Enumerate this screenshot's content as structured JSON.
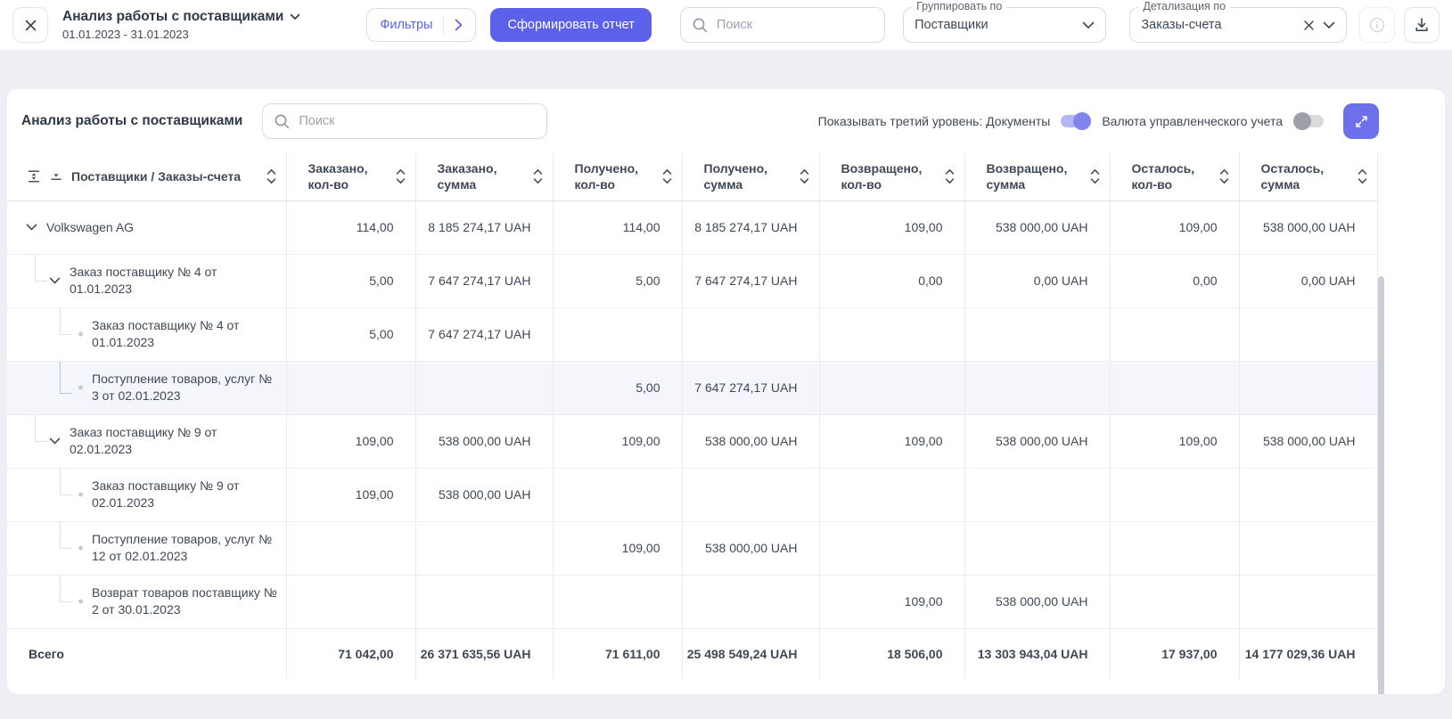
{
  "colors": {
    "accent": "#5c61e9",
    "accent_button": "#6c70ea",
    "toggle_on_track": "#b4b7f4",
    "toggle_on_knob": "#8084ee",
    "toggle_off_knob": "#99a0a9",
    "highlight_row": "#f5f6fc",
    "page_background": "#edeff4"
  },
  "icons": {
    "close": "×",
    "title_chevron": "∨",
    "filters_chevron": "›",
    "search": "⌕",
    "dropdown_chevron": "∨",
    "clear": "×",
    "info": "ⓘ",
    "download": "⭳",
    "expand": "⤢",
    "sort": "∧∨",
    "expand_all_rows": "⇕",
    "collapse_all_rows": "⤓",
    "row_chevron": "∨",
    "doc_bullet": "•"
  },
  "topbar": {
    "title": "Анализ работы с поставщиками",
    "date_range": "01.01.2023 - 31.01.2023",
    "filters_button": "Фильтры",
    "generate_report_button": "Сформировать отчет",
    "search_placeholder": "Поиск",
    "group_by_label": "Группировать по",
    "group_by_value": "Поставщики",
    "detail_by_label": "Детализация по",
    "detail_by_value": "Заказы-счета"
  },
  "panel": {
    "title": "Анализ работы с поставщиками",
    "search_placeholder": "Поиск",
    "third_level_toggle_label": "Показывать третий уровень: Документы",
    "third_level_toggle_on": true,
    "currency_toggle_label": "Валюта управленческого учета",
    "currency_toggle_on": false
  },
  "table": {
    "columns": [
      {
        "title": "Поставщики / Заказы-счета",
        "sub": ""
      },
      {
        "title": "Заказано,",
        "sub": "кол-во"
      },
      {
        "title": "Заказано,",
        "sub": "сумма"
      },
      {
        "title": "Получено,",
        "sub": "кол-во"
      },
      {
        "title": "Получено,",
        "sub": "сумма"
      },
      {
        "title": "Возвращено,",
        "sub": "кол-во"
      },
      {
        "title": "Возвращено,",
        "sub": "сумма"
      },
      {
        "title": "Осталось,",
        "sub": "кол-во"
      },
      {
        "title": "Осталось,",
        "sub": "сумма"
      }
    ],
    "rows": [
      {
        "level": 0,
        "expandable": true,
        "highlighted": false,
        "label": "Volkswagen AG",
        "cells": [
          "114,00",
          "8 185 274,17 UAH",
          "114,00",
          "8 185 274,17 UAH",
          "109,00",
          "538 000,00 UAH",
          "109,00",
          "538 000,00 UAH"
        ]
      },
      {
        "level": 1,
        "expandable": true,
        "highlighted": false,
        "label": "Заказ поставщику № 4 от 01.01.2023",
        "cells": [
          "5,00",
          "7 647 274,17 UAH",
          "5,00",
          "7 647 274,17 UAH",
          "0,00",
          "0,00 UAH",
          "0,00",
          "0,00 UAH"
        ]
      },
      {
        "level": 2,
        "expandable": false,
        "highlighted": false,
        "label": "Заказ поставщику № 4 от 01.01.2023",
        "cells": [
          "5,00",
          "7 647 274,17 UAH",
          "",
          "",
          "",
          "",
          "",
          ""
        ]
      },
      {
        "level": 2,
        "expandable": false,
        "highlighted": true,
        "label": "Поступление товаров, услуг № 3 от 02.01.2023",
        "cells": [
          "",
          "",
          "5,00",
          "7 647 274,17 UAH",
          "",
          "",
          "",
          ""
        ]
      },
      {
        "level": 1,
        "expandable": true,
        "highlighted": false,
        "label": "Заказ поставщику № 9 от 02.01.2023",
        "cells": [
          "109,00",
          "538 000,00 UAH",
          "109,00",
          "538 000,00 UAH",
          "109,00",
          "538 000,00 UAH",
          "109,00",
          "538 000,00 UAH"
        ]
      },
      {
        "level": 2,
        "expandable": false,
        "highlighted": false,
        "label": "Заказ поставщику № 9 от 02.01.2023",
        "cells": [
          "109,00",
          "538 000,00 UAH",
          "",
          "",
          "",
          "",
          "",
          ""
        ]
      },
      {
        "level": 2,
        "expandable": false,
        "highlighted": false,
        "label": "Поступление товаров, услуг № 12 от 02.01.2023",
        "cells": [
          "",
          "",
          "109,00",
          "538 000,00 UAH",
          "",
          "",
          "",
          ""
        ]
      },
      {
        "level": 2,
        "expandable": false,
        "highlighted": false,
        "label": "Возврат товаров поставщику № 2 от 30.01.2023",
        "cells": [
          "",
          "",
          "",
          "",
          "109,00",
          "538 000,00 UAH",
          "",
          ""
        ]
      }
    ],
    "footer": {
      "label": "Всего",
      "cells": [
        "71 042,00",
        "26 371 635,56 UAH",
        "71 611,00",
        "25 498 549,24 UAH",
        "18 506,00",
        "13 303 943,04 UAH",
        "17 937,00",
        "14 177 029,36 UAH"
      ]
    }
  }
}
